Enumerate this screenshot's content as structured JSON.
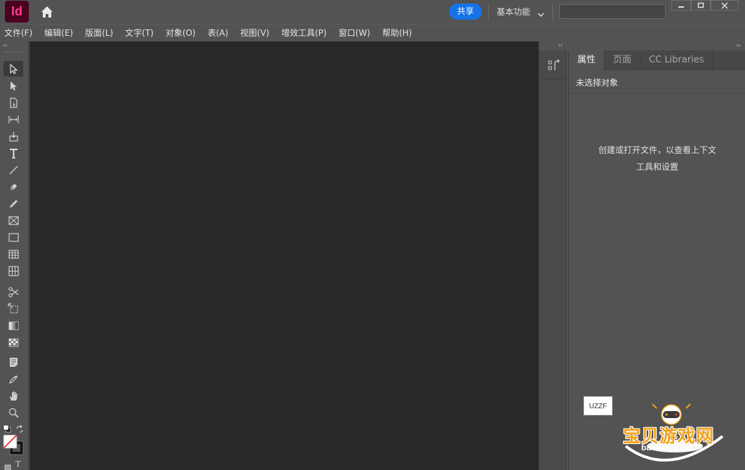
{
  "app": {
    "logo_text": "Id",
    "brand_color": "#ff3c8b",
    "logo_bg": "#49021f"
  },
  "topbar": {
    "share_label": "共享",
    "workspace_label": "基本功能",
    "search_value": "",
    "icons": [
      "home-icon",
      "chevron-down-icon",
      "minimize-icon",
      "maximize-icon",
      "close-icon"
    ],
    "accent_color": "#1473e6"
  },
  "menu": [
    "文件(F)",
    "编辑(E)",
    "版面(L)",
    "文字(T)",
    "对象(O)",
    "表(A)",
    "视图(V)",
    "增效工具(P)",
    "窗口(W)",
    "帮助(H)"
  ],
  "tools": {
    "collapse_glyph": "››",
    "items": [
      "selection-tool",
      "direct-selection-tool",
      "page-tool",
      "gap-tool",
      "content-collector-tool",
      "type-tool",
      "line-tool",
      "pen-tool",
      "pencil-tool",
      "rectangle-frame-tool",
      "rectangle-tool",
      "table-tool",
      "grid-tool",
      "scissors-tool",
      "free-transform-tool",
      "gradient-swatch-tool",
      "gradient-feather-tool",
      "note-tool",
      "eyedropper-tool",
      "hand-tool",
      "zoom-tool"
    ],
    "type_glyph": "T"
  },
  "strip": {
    "collapse_glyph": "‹‹"
  },
  "properties_panel": {
    "collapse_glyph": "››",
    "tabs": [
      "属性",
      "页面",
      "CC Libraries"
    ],
    "active_tab": "属性",
    "no_selection": "未选择对象",
    "hint_line1": "创建或打开文件，以查看上下文",
    "hint_line2": "工具和设置"
  },
  "watermark": {
    "badge": "UZZF",
    "title": "宝贝游戏网",
    "url": "baobeiy.com"
  }
}
